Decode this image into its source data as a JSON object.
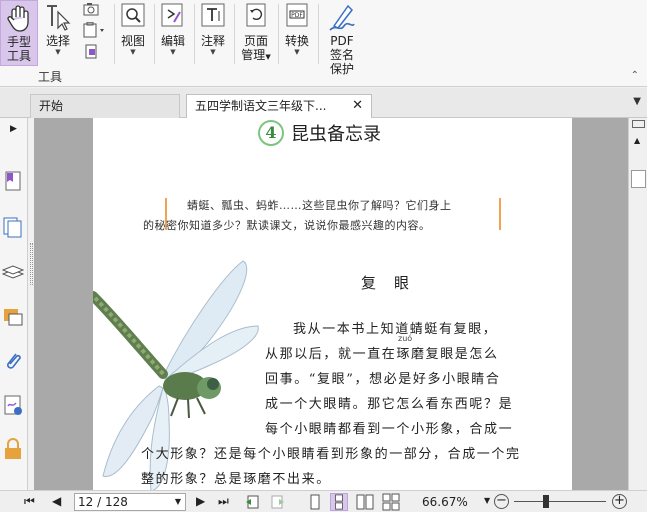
{
  "ribbon": {
    "hand_tool_label_1": "手型",
    "hand_tool_label_2": "工具",
    "select_label": "选择",
    "view_label": "视图",
    "edit_label": "编辑",
    "annotate_label": "注释",
    "page_manage_label_1": "页面",
    "page_manage_label_2": "管理",
    "convert_label": "转换",
    "pdf_sign_label_1": "PDF",
    "pdf_sign_label_2": "签名",
    "pdf_sign_label_3": "保护",
    "group_tools_label": "工具"
  },
  "tabs": [
    {
      "label": "开始"
    },
    {
      "label": "五四学制语文三年级下..."
    }
  ],
  "document": {
    "lesson_number": "4",
    "lesson_title": "昆虫备忘录",
    "intro_line_1": "蜻蜓、瓢虫、蚂蚱……这些昆虫你了解吗？它们身上",
    "intro_line_2": "的秘密你知道多少？默读课文，说说你最感兴趣的内容。",
    "section_title": "复眼",
    "pinyin": "zuó",
    "body_lines": [
      "我从一本书上知道蜻蜓有复眼，",
      "从那以后，就一直在琢磨复眼是怎么",
      "回事。“复眼”，想必是好多小眼睛合",
      "成一个大眼睛。那它怎么看东西呢？是",
      "每个小眼睛都看到一个小形象，合成一",
      "个大形象？还是每个小眼睛看到形象的一部分，合成一个完",
      "整的形象？总是琢磨不出来。"
    ]
  },
  "statusbar": {
    "page_display": "12 / 128",
    "zoom": "66.67%"
  },
  "colors": {
    "accent": "#d8c7ea",
    "intro_bar": "#f2a253",
    "lesson_circle": "#7cc57d"
  },
  "icons": [
    "hand-icon",
    "select-icon",
    "camera-icon",
    "clipboard-icon",
    "view-icon",
    "edit-icon",
    "annotate-icon",
    "page-manage-icon",
    "convert-icon",
    "pdf-sign-icon"
  ]
}
